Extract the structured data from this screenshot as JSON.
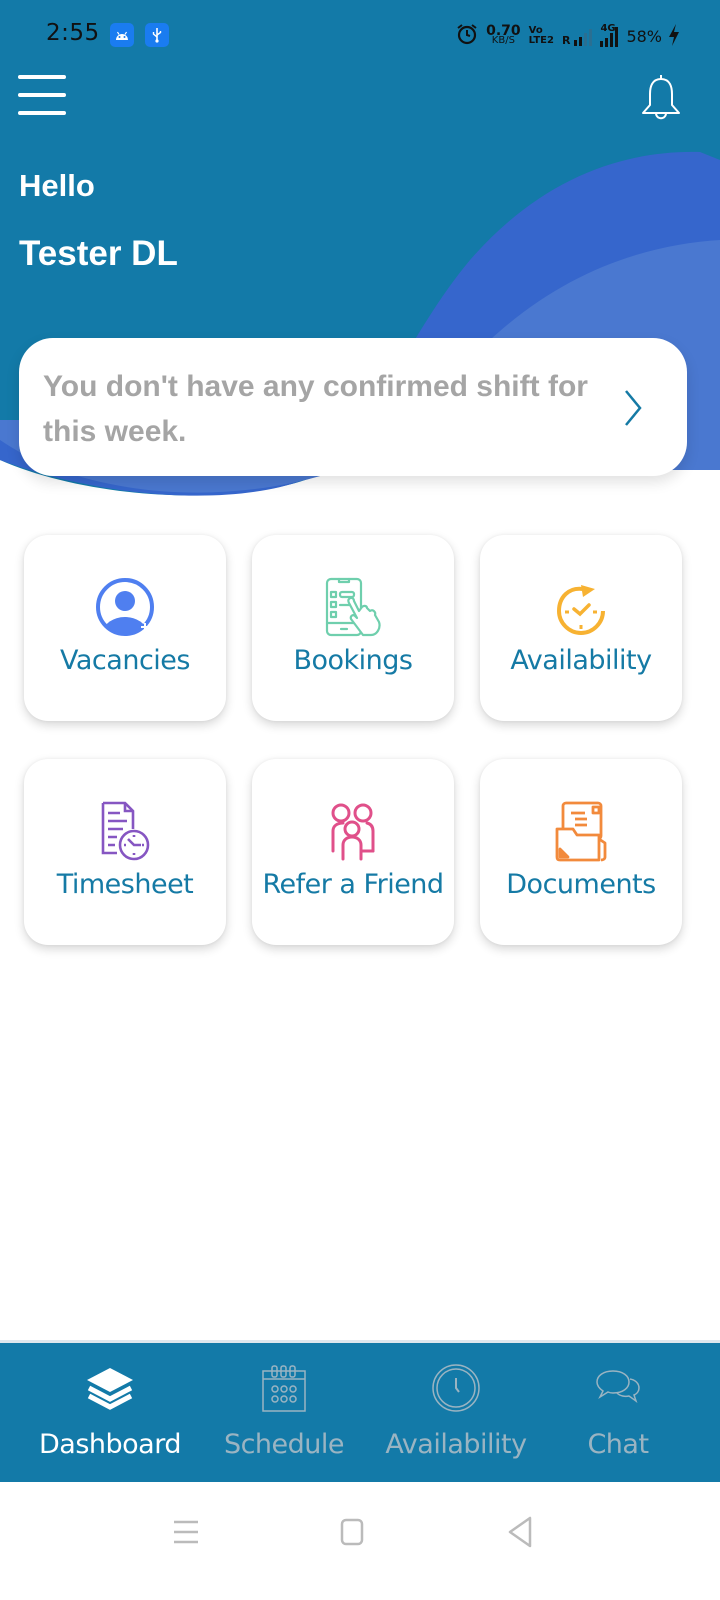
{
  "status_bar": {
    "time": "2:55",
    "notification_icons": [
      "android-icon",
      "usb-icon"
    ],
    "network_speed_value": "0.70",
    "network_speed_unit": "KB/S",
    "volte_top": "Vo",
    "volte_bottom": "LTE2",
    "roaming": "R",
    "network_type": "4G",
    "battery": "58%"
  },
  "header": {
    "greeting": "Hello",
    "user_name": "Tester DL"
  },
  "shift_card": {
    "message": "You don't have any confirmed shift for this week."
  },
  "tiles": [
    {
      "label": "Vacancies",
      "icon": "vacancies-user-icon",
      "color": "#4f7ff0"
    },
    {
      "label": "Bookings",
      "icon": "bookings-phone-tap-icon",
      "color": "#6fcfad"
    },
    {
      "label": "Availability",
      "icon": "availability-clock-icon",
      "color": "#f7b232"
    },
    {
      "label": "Timesheet",
      "icon": "timesheet-document-clock-icon",
      "color": "#8656c2"
    },
    {
      "label": "Refer a Friend",
      "icon": "refer-friends-icon",
      "color": "#e0508a"
    },
    {
      "label": "Documents",
      "icon": "documents-folder-icon",
      "color": "#f28a3c"
    }
  ],
  "bottom_nav": {
    "items": [
      {
        "label": "Dashboard",
        "icon": "layers-icon",
        "active": true
      },
      {
        "label": "Schedule",
        "icon": "calendar-icon",
        "active": false
      },
      {
        "label": "Availability",
        "icon": "clock-icon",
        "active": false
      },
      {
        "label": "Chat",
        "icon": "chat-bubbles-icon",
        "active": false
      }
    ]
  },
  "colors": {
    "header_bg": "#137aa8",
    "wave_dark": "#3666cc",
    "wave_light": "#4a78d0",
    "label_text": "#157aa5",
    "inactive_nav": "#9ab4c2"
  }
}
